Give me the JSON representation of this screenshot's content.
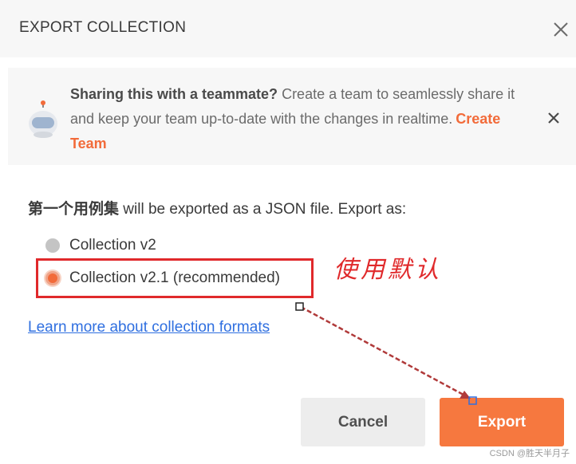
{
  "dialog": {
    "title": "EXPORT COLLECTION"
  },
  "banner": {
    "heading": "Sharing this with a teammate?",
    "body": " Create a team to seamlessly share it and keep your team up-to-date with the changes in realtime.",
    "link": "Create Team"
  },
  "export": {
    "collection_name": "第一个用例集",
    "description": " will be exported as a JSON file. Export as:",
    "options": [
      {
        "label": "Collection v2",
        "selected": false
      },
      {
        "label": "Collection v2.1 (recommended)",
        "selected": true
      }
    ],
    "learn_more": "Learn more about collection formats"
  },
  "buttons": {
    "cancel": "Cancel",
    "export": "Export"
  },
  "annotation": {
    "text": "使用默认",
    "color": "#e0292b"
  },
  "watermark": "CSDN @胜天半月子",
  "colors": {
    "accent": "#f26b3a",
    "link": "#2f6fe0",
    "annotation": "#e0292b"
  }
}
